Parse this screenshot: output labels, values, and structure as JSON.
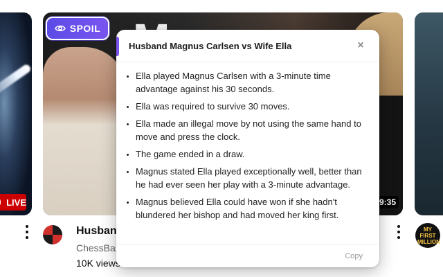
{
  "left_video": {
    "live_label": "LIVE"
  },
  "main_video": {
    "thumb_text": "M",
    "duration": "9:35",
    "title": "Husband",
    "channel": "ChessBas",
    "views": "10K views"
  },
  "spoil_button": {
    "label": "SPOIL",
    "icon": "eye-icon",
    "color": "#6a4ff0"
  },
  "popup": {
    "title": "Husband Magnus Carlsen vs Wife Ella",
    "close_label": "×",
    "bullets": [
      "Ella played Magnus Carlsen with a 3-minute time advantage against his 30 seconds.",
      "Ella was required to survive 30 moves.",
      "Ella made an illegal move by not using the same hand to move and press the clock.",
      "The game ended in a draw.",
      "Magnus stated Ella played exceptionally well, better than he had ever seen her play with a 3-minute advantage.",
      "Magnus believed Ella could have won if she hadn't blundered her bishop and had moved her king first."
    ],
    "copy_label": "Copy"
  },
  "right_channel": {
    "avatar_text": "MY FIRST MILLION"
  },
  "colors": {
    "accent": "#7a55f0",
    "live_red": "#cc0000"
  }
}
